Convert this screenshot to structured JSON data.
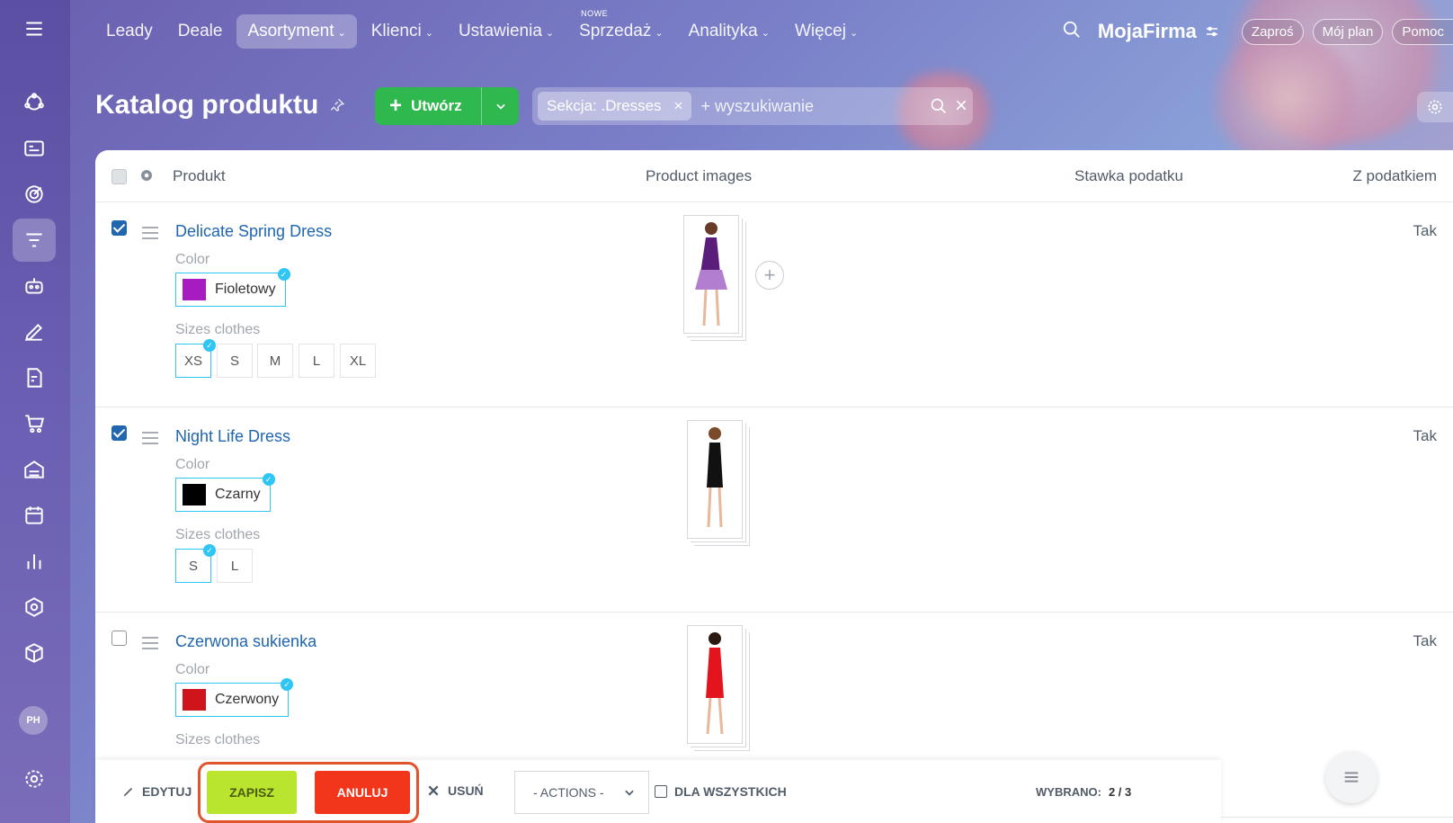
{
  "nav": {
    "items": [
      {
        "label": "Leady",
        "chevron": false
      },
      {
        "label": "Deale",
        "chevron": false
      },
      {
        "label": "Asortyment",
        "chevron": true,
        "active": true
      },
      {
        "label": "Klienci",
        "chevron": true
      },
      {
        "label": "Ustawienia",
        "chevron": true
      },
      {
        "label": "Sprzedaż",
        "chevron": true,
        "badge": "NOWE"
      },
      {
        "label": "Analityka",
        "chevron": true
      },
      {
        "label": "Więcej",
        "chevron": true
      }
    ],
    "brand": "MojaFirma",
    "invite": "Zaproś",
    "my_plan": "Mój plan",
    "help": "Pomoc"
  },
  "sidebar": {
    "avatar": "PH"
  },
  "header": {
    "title": "Katalog produktu",
    "create_label": "Utwórz",
    "filter_chip": "Sekcja: .Dresses",
    "search_placeholder": "+ wyszukiwanie"
  },
  "table": {
    "columns": {
      "product": "Produkt",
      "images": "Product images",
      "tax_rate": "Stawka podatku",
      "with_tax": "Z podatkiem"
    },
    "rows": [
      {
        "name": "Delicate Spring Dress",
        "checked": true,
        "color_label": "Color",
        "color_name": "Fioletowy",
        "color_hex": "#a61cc0",
        "sizes_label": "Sizes clothes",
        "sizes": [
          "XS",
          "S",
          "M",
          "L",
          "XL"
        ],
        "selected_size": "XS",
        "with_tax": "Tak"
      },
      {
        "name": "Night Life Dress",
        "checked": true,
        "color_label": "Color",
        "color_name": "Czarny",
        "color_hex": "#000000",
        "sizes_label": "Sizes clothes",
        "sizes": [
          "S",
          "L"
        ],
        "selected_size": "S",
        "with_tax": "Tak"
      },
      {
        "name": "Czerwona sukienka",
        "checked": false,
        "color_label": "Color",
        "color_name": "Czerwony",
        "color_hex": "#d0141b",
        "sizes_label": "Sizes clothes",
        "with_tax": "Tak"
      }
    ]
  },
  "actionbar": {
    "edit": "EDYTUJ",
    "save": "ZAPISZ",
    "cancel": "ANULUJ",
    "delete": "USUŃ",
    "actions": "- ACTIONS -",
    "for_all": "DLA WSZYSTKICH",
    "selected_label": "WYBRANO:",
    "selected_count": "2 / 3"
  }
}
